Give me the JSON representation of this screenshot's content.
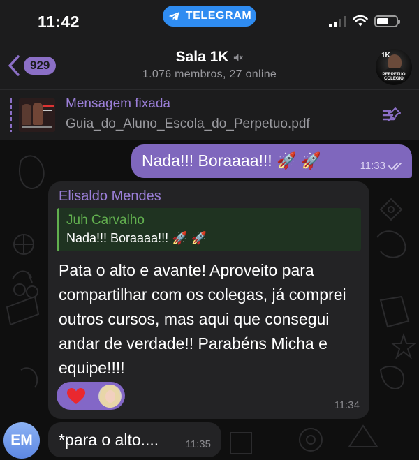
{
  "status_bar": {
    "time": "11:42",
    "app_pill": "TELEGRAM"
  },
  "header": {
    "back_count": "929",
    "title": "Sala 1K",
    "subtitle": "1.076 membros, 27 online",
    "muted": true,
    "avatar": {
      "badge_text": "1K",
      "caption": "PERPETUO COLEGIO"
    }
  },
  "pinned": {
    "label": "Mensagem fixada",
    "file": "Guia_do_Aluno_Escola_do_Perpetuo.pdf"
  },
  "messages": {
    "outgoing": {
      "text": "Nada!!! Boraaaa!!!",
      "time": "11:33",
      "read": true
    },
    "incoming": {
      "sender": "Elisaldo Mendes",
      "reply": {
        "name": "Juh Carvalho",
        "text": "Nada!!! Boraaaa!!!"
      },
      "body": "Pata o alto e avante! Aproveito para compartilhar com os colegas, já comprei outros cursos, mas aqui que consegui andar de verdade!! Parabéns Micha e equipe!!!!",
      "reaction": "heart",
      "time": "11:34"
    },
    "incoming2": {
      "avatar_initials": "EM",
      "text": "*para o alto....",
      "time": "11:35"
    }
  },
  "colors": {
    "accent_purple": "#8b6fc6",
    "outgoing_bubble": "#7f67bd",
    "incoming_bubble": "#232325",
    "reply_green": "#62b04f",
    "telegram_blue": "#2f8cf1"
  }
}
